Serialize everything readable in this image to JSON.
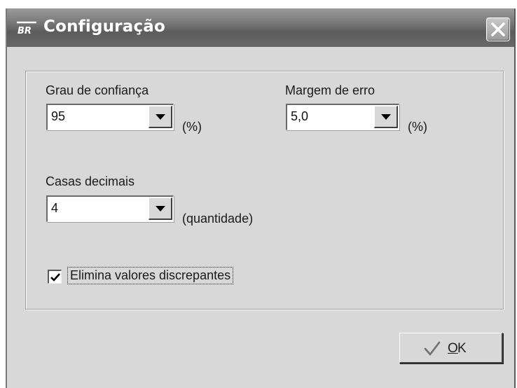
{
  "window": {
    "title": "Configuração",
    "logo_text": "BR",
    "close_icon": "close-icon"
  },
  "fields": {
    "confidence": {
      "label": "Grau de confiança",
      "value": "95",
      "unit": "(%)"
    },
    "margin": {
      "label": "Margem de erro",
      "value": "5,0",
      "unit": "(%)"
    },
    "decimals": {
      "label": "Casas decimais",
      "value": "4",
      "unit": "(quantidade)"
    }
  },
  "checkbox": {
    "label": "Elimina valores discrepantes",
    "checked": true
  },
  "ok_button": {
    "mnemonic": "O",
    "label_rest": "K",
    "icon": "checkmark-icon"
  },
  "colors": {
    "titlebar": "#6f6f6f",
    "dialog_bg": "#d8d8d8"
  }
}
